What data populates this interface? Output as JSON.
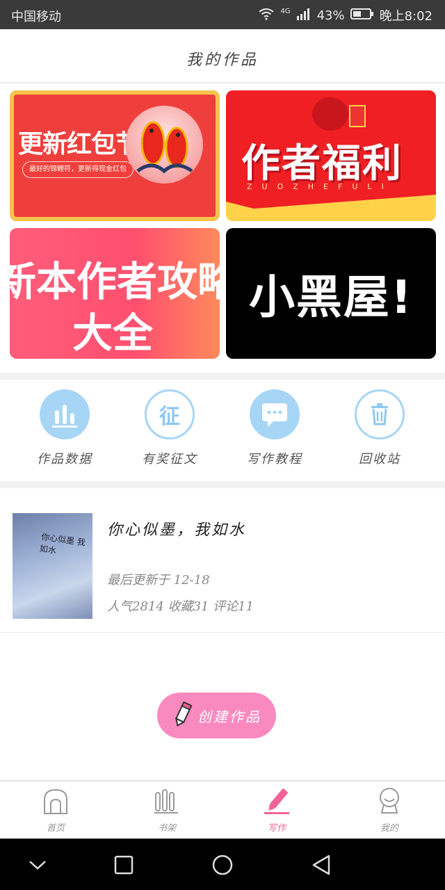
{
  "status_bar": {
    "carrier": "中国移动",
    "network": "4G",
    "battery": "43%",
    "time": "晚上8:02"
  },
  "header": {
    "title": "我的作品"
  },
  "banners": {
    "b1": {
      "text": "更新红包节",
      "sub": "最好的锦鲤符，更新得现金红包"
    },
    "b2": {
      "text": "作者福利",
      "pinyin": "ZUOZHEFULI"
    },
    "b3": {
      "line1": "新本作者攻略",
      "line2": "大全"
    },
    "b4": {
      "text": "小黑屋!"
    }
  },
  "actions": [
    {
      "label": "作品数据",
      "icon": "bar-chart-icon"
    },
    {
      "label": "有奖征文",
      "icon": "zheng-icon",
      "glyph": "征"
    },
    {
      "label": "写作教程",
      "icon": "chat-bubble-icon"
    },
    {
      "label": "回收站",
      "icon": "trash-icon"
    }
  ],
  "work": {
    "title": "你心似墨，我如水",
    "cover_text": "你心似墨 我如水",
    "updated": "最后更新于 12-18",
    "stats": "人气2814 收藏31 评论11"
  },
  "create_button": {
    "label": "创建作品"
  },
  "tabbar": {
    "home": "首页",
    "shelf": "书架",
    "write": "写作",
    "mine": "我的"
  },
  "colors": {
    "accent_pink": "#f06495",
    "create_pink": "#f98ac0",
    "icon_blue": "#a6d5f5"
  }
}
